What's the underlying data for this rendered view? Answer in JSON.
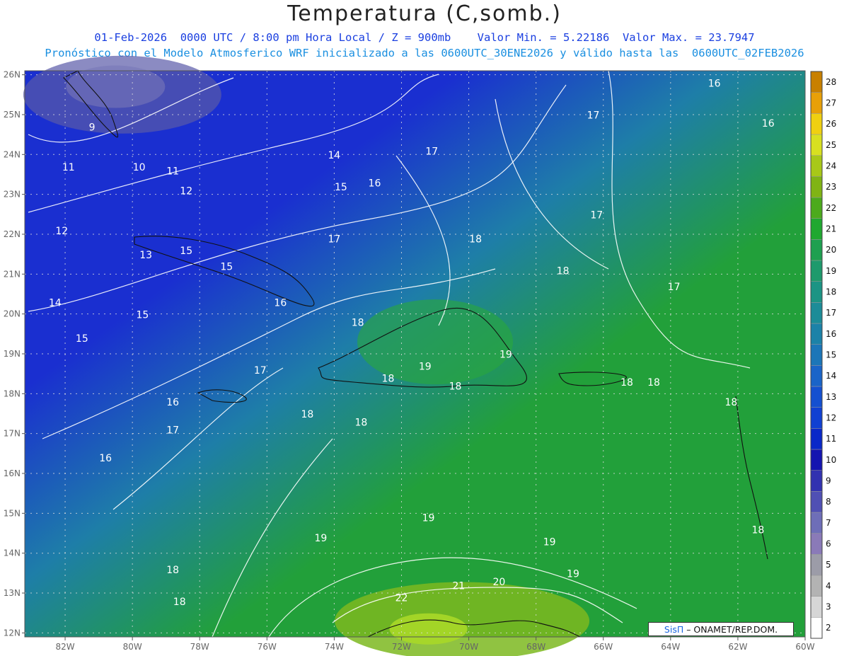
{
  "title": "Temperatura (C,somb.)",
  "subtitle_line1": "01-Feb-2026  0000 UTC / 8:00 pm Hora Local / Z = 900mb    Valor Min. = 5.22186  Valor Max. = 23.7947",
  "subtitle_line2": "Pronóstico con el Modelo Atmosferico WRF inicializado a las 0600UTC_30ENE2026 y válido hasta las  0600UTC_02FEB2026",
  "credit": {
    "brand": "SisΠ",
    "text": " – ONAMET/REP.DOM."
  },
  "colors": {
    "cool": "#1a2fd0",
    "mid": "#1e7ea8",
    "warm": "#22a03a",
    "hot": "#7cb820"
  },
  "chart_data": {
    "type": "heatmap",
    "lon_range": [
      -83.2,
      -60.0
    ],
    "lat_range": [
      11.9,
      26.1
    ],
    "x_tick_labels": [
      "82W",
      "80W",
      "78W",
      "76W",
      "74W",
      "72W",
      "70W",
      "68W",
      "66W",
      "64W",
      "62W",
      "60W"
    ],
    "x_tick_values": [
      -82,
      -80,
      -78,
      -76,
      -74,
      -72,
      -70,
      -68,
      -66,
      -64,
      -62,
      -60
    ],
    "y_tick_labels": [
      "26N",
      "25N",
      "24N",
      "23N",
      "22N",
      "21N",
      "20N",
      "19N",
      "18N",
      "17N",
      "16N",
      "15N",
      "14N",
      "13N",
      "12N"
    ],
    "y_tick_values": [
      26,
      25,
      24,
      23,
      22,
      21,
      20,
      19,
      18,
      17,
      16,
      15,
      14,
      13,
      12
    ],
    "colorbar": {
      "levels": [
        2,
        3,
        4,
        5,
        6,
        7,
        8,
        9,
        10,
        11,
        12,
        13,
        14,
        15,
        16,
        17,
        18,
        19,
        20,
        21,
        22,
        23,
        24,
        25,
        26,
        27,
        28
      ],
      "colors": [
        "#ffffff",
        "#d6d6d6",
        "#b3b3b3",
        "#9c9ca8",
        "#8a7ab8",
        "#6e6eb8",
        "#5050b4",
        "#3232b0",
        "#1414b0",
        "#0a28c8",
        "#1040d2",
        "#1450d0",
        "#1a64c8",
        "#1c76b8",
        "#1c82a8",
        "#1c8c98",
        "#1c9484",
        "#1e9a6c",
        "#1ea050",
        "#20a830",
        "#4caa1c",
        "#80b414",
        "#a8c818",
        "#d8e020",
        "#f0d010",
        "#e8a008",
        "#c88000"
      ]
    },
    "contour_labels": [
      {
        "text": "9",
        "lon": -81.2,
        "lat": 24.6
      },
      {
        "text": "10",
        "lon": -79.8,
        "lat": 23.6
      },
      {
        "text": "11",
        "lon": -81.9,
        "lat": 23.6
      },
      {
        "text": "11",
        "lon": -78.8,
        "lat": 23.5
      },
      {
        "text": "12",
        "lon": -78.4,
        "lat": 23.0
      },
      {
        "text": "12",
        "lon": -82.1,
        "lat": 22.0
      },
      {
        "text": "13",
        "lon": -79.6,
        "lat": 21.4
      },
      {
        "text": "14",
        "lon": -74.0,
        "lat": 23.9
      },
      {
        "text": "15",
        "lon": -73.8,
        "lat": 23.1
      },
      {
        "text": "16",
        "lon": -72.8,
        "lat": 23.2
      },
      {
        "text": "17",
        "lon": -71.1,
        "lat": 24.0
      },
      {
        "text": "17",
        "lon": -66.3,
        "lat": 24.9
      },
      {
        "text": "16",
        "lon": -62.7,
        "lat": 25.7
      },
      {
        "text": "16",
        "lon": -61.1,
        "lat": 24.7
      },
      {
        "text": "17",
        "lon": -66.2,
        "lat": 22.4
      },
      {
        "text": "15",
        "lon": -78.4,
        "lat": 21.5
      },
      {
        "text": "15",
        "lon": -77.2,
        "lat": 21.1
      },
      {
        "text": "14",
        "lon": -82.3,
        "lat": 20.2
      },
      {
        "text": "15",
        "lon": -79.7,
        "lat": 19.9
      },
      {
        "text": "15",
        "lon": -81.5,
        "lat": 19.3
      },
      {
        "text": "16",
        "lon": -75.6,
        "lat": 20.2
      },
      {
        "text": "17",
        "lon": -74.0,
        "lat": 21.8
      },
      {
        "text": "18",
        "lon": -69.8,
        "lat": 21.8
      },
      {
        "text": "18",
        "lon": -67.2,
        "lat": 21.0
      },
      {
        "text": "17",
        "lon": -63.9,
        "lat": 20.6
      },
      {
        "text": "18",
        "lon": -73.3,
        "lat": 19.7
      },
      {
        "text": "19",
        "lon": -68.9,
        "lat": 18.9
      },
      {
        "text": "19",
        "lon": -71.3,
        "lat": 18.6
      },
      {
        "text": "18",
        "lon": -72.4,
        "lat": 18.3
      },
      {
        "text": "18",
        "lon": -70.4,
        "lat": 18.1
      },
      {
        "text": "18",
        "lon": -65.3,
        "lat": 18.2
      },
      {
        "text": "18",
        "lon": -64.5,
        "lat": 18.2
      },
      {
        "text": "18",
        "lon": -62.2,
        "lat": 17.7
      },
      {
        "text": "17",
        "lon": -76.2,
        "lat": 18.5
      },
      {
        "text": "16",
        "lon": -78.8,
        "lat": 17.7
      },
      {
        "text": "17",
        "lon": -78.8,
        "lat": 17.0
      },
      {
        "text": "18",
        "lon": -74.8,
        "lat": 17.4
      },
      {
        "text": "18",
        "lon": -73.2,
        "lat": 17.2
      },
      {
        "text": "16",
        "lon": -80.8,
        "lat": 16.3
      },
      {
        "text": "19",
        "lon": -71.2,
        "lat": 14.8
      },
      {
        "text": "19",
        "lon": -74.4,
        "lat": 14.3
      },
      {
        "text": "19",
        "lon": -67.6,
        "lat": 14.2
      },
      {
        "text": "19",
        "lon": -66.9,
        "lat": 13.4
      },
      {
        "text": "18",
        "lon": -61.4,
        "lat": 14.5
      },
      {
        "text": "18",
        "lon": -78.8,
        "lat": 13.5
      },
      {
        "text": "18",
        "lon": -78.6,
        "lat": 12.7
      },
      {
        "text": "21",
        "lon": -70.3,
        "lat": 13.1
      },
      {
        "text": "20",
        "lon": -69.1,
        "lat": 13.2
      },
      {
        "text": "22",
        "lon": -72.0,
        "lat": 12.8
      }
    ]
  }
}
